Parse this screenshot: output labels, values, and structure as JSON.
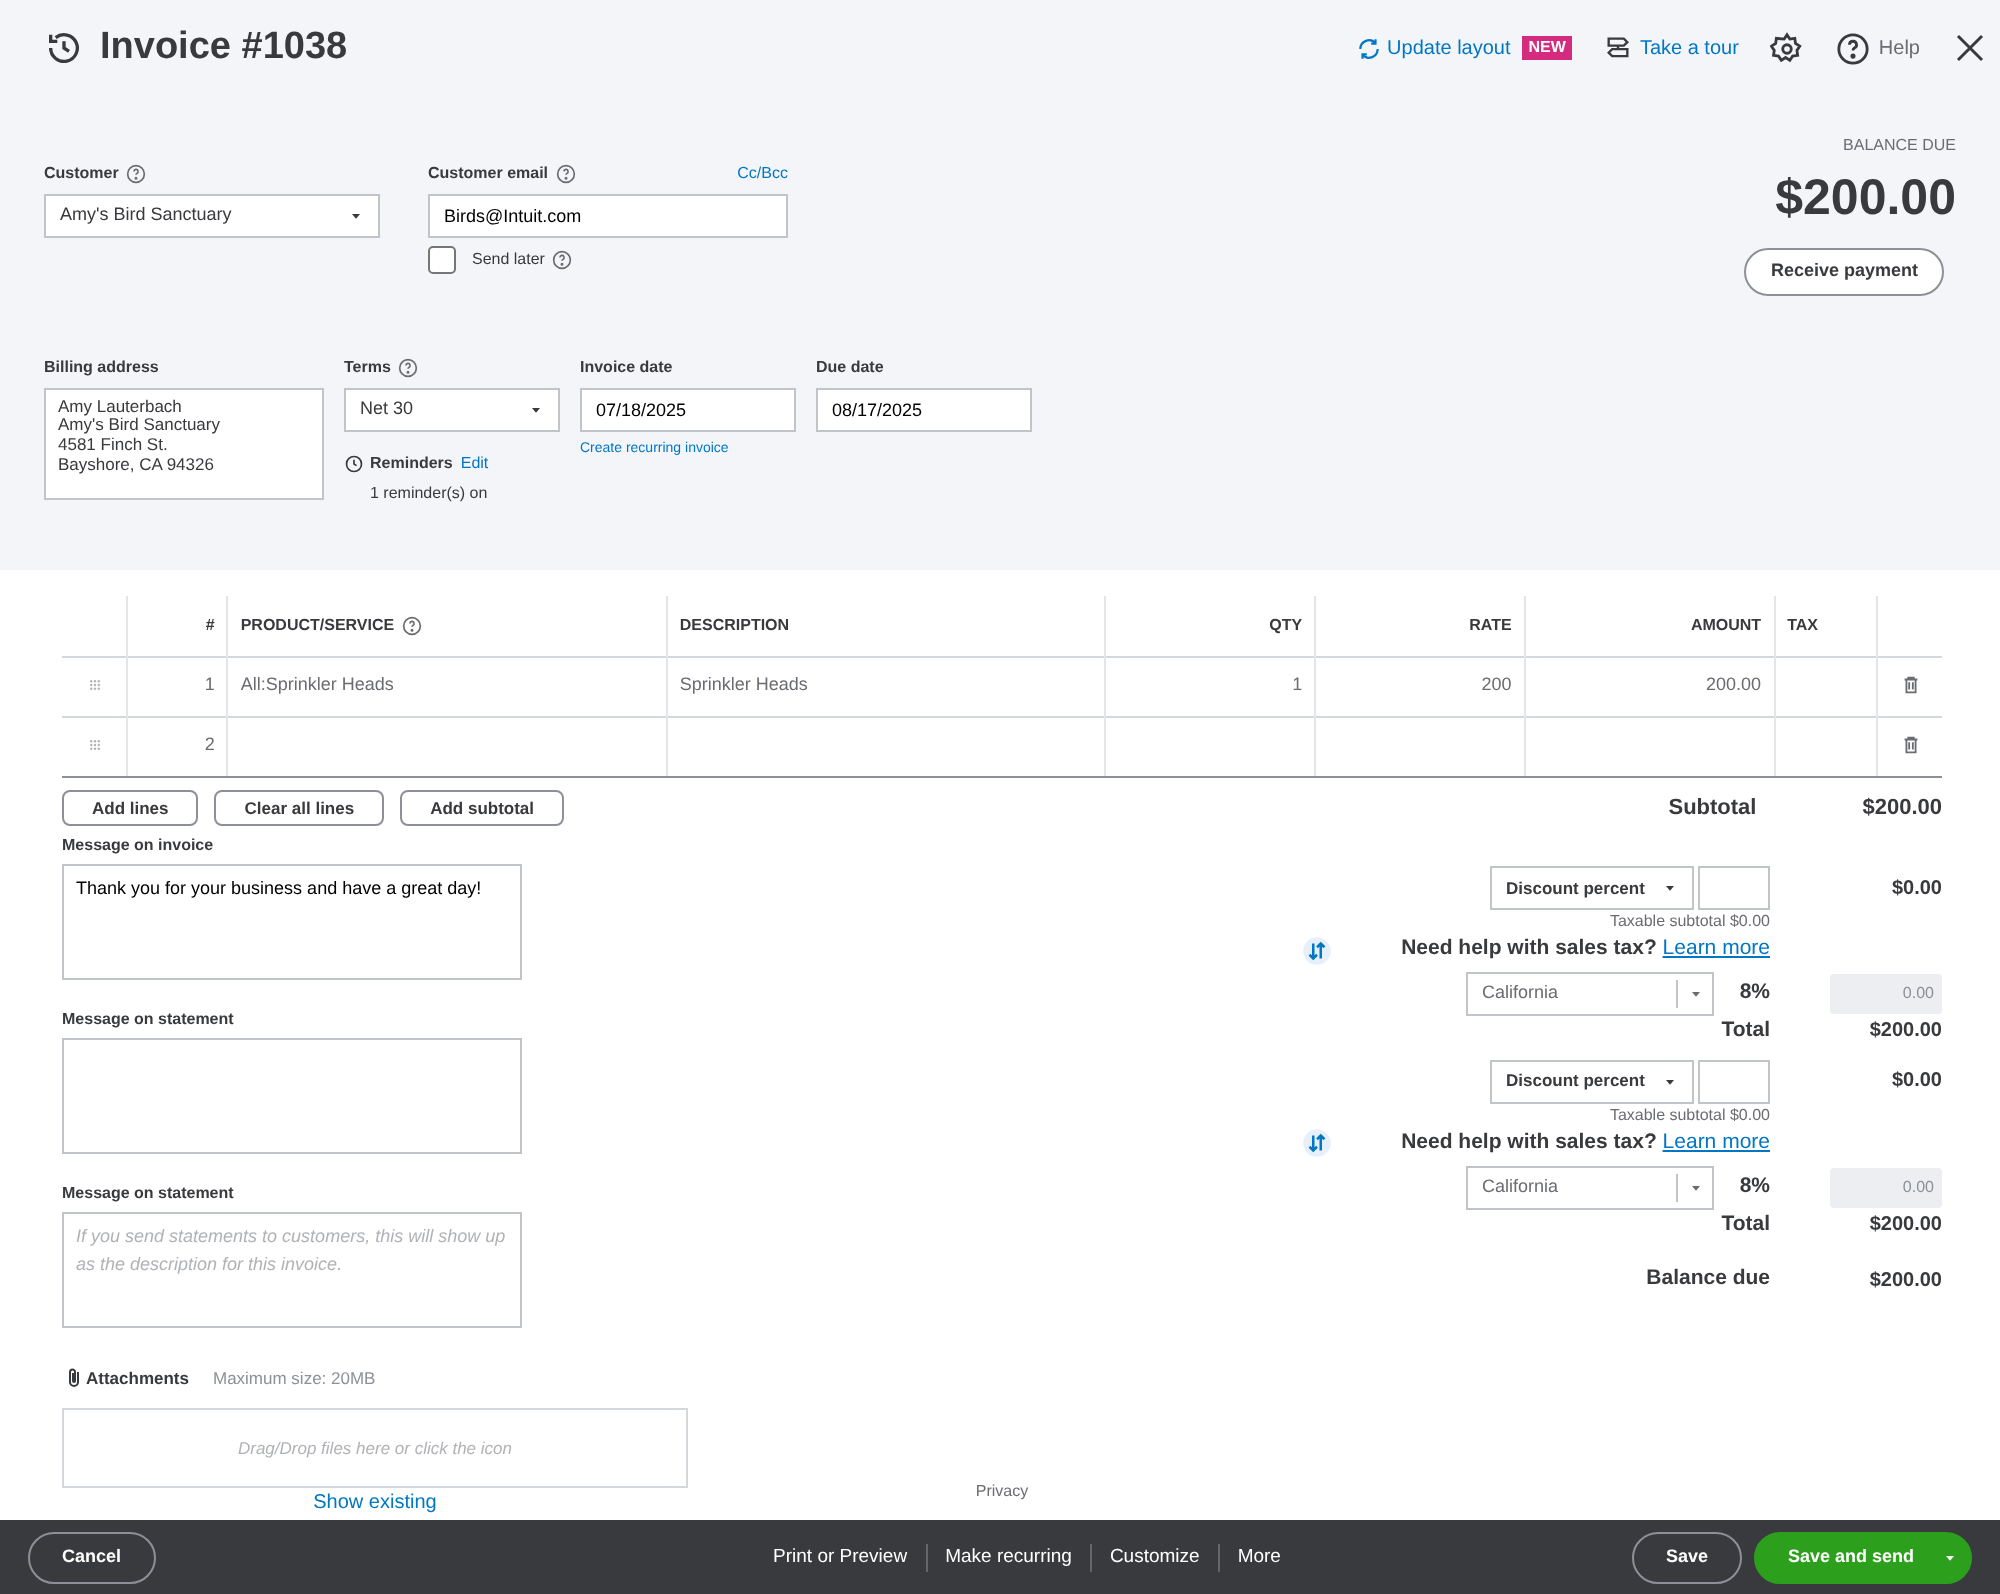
{
  "header": {
    "title": "Invoice #1038",
    "update_layout": "Update layout",
    "new_badge": "NEW",
    "take_tour": "Take a tour",
    "help": "Help"
  },
  "customer": {
    "label": "Customer",
    "value": "Amy's Bird Sanctuary"
  },
  "email": {
    "label": "Customer email",
    "value": "Birds@Intuit.com",
    "cc_bcc": "Cc/Bcc",
    "send_later": {
      "label": "Send later",
      "checked": false
    }
  },
  "balance": {
    "label": "BALANCE DUE",
    "amount": "$200.00",
    "button": "Receive payment"
  },
  "billing": {
    "label": "Billing address",
    "lines": [
      "Amy Lauterbach",
      "Amy's Bird Sanctuary",
      "4581 Finch St.",
      "Bayshore, CA  94326"
    ]
  },
  "terms": {
    "label": "Terms",
    "value": "Net 30"
  },
  "invoice_date": {
    "label": "Invoice date",
    "value": "07/18/2025",
    "link": "Create recurring invoice"
  },
  "due_date": {
    "label": "Due date",
    "value": "08/17/2025"
  },
  "reminders": {
    "label": "Reminders",
    "edit": "Edit",
    "status": "1 reminder(s) on"
  },
  "table": {
    "columns": [
      "#",
      "PRODUCT/SERVICE",
      "DESCRIPTION",
      "QTY",
      "RATE",
      "AMOUNT",
      "TAX"
    ],
    "rows": [
      {
        "num": "1",
        "product": "All:Sprinkler Heads",
        "description": "Sprinkler Heads",
        "qty": "1",
        "rate": "200",
        "amount": "200.00"
      },
      {
        "num": "2"
      }
    ]
  },
  "line_buttons": [
    "Add lines",
    "Clear all lines",
    "Add subtotal"
  ],
  "subtotal": {
    "label": "Subtotal",
    "value": "$200.00"
  },
  "messages": [
    {
      "label": "Message on invoice",
      "value": "Thank you for your business and have a great day!"
    },
    {
      "label": "Message on statement"
    },
    {
      "label": "Message on statement",
      "placeholder": "If you send statements to customers, this will show up as the description for this invoice."
    }
  ],
  "attachments": {
    "label": "Attachments",
    "max": "Maximum size: 20MB",
    "drop": "Drag/Drop files here or click the icon",
    "show": "Show existing"
  },
  "tax_blocks": [
    {
      "discount": "Discount percent",
      "discount_amount": "$0.00",
      "taxable": "Taxable subtotal $0.00",
      "help": "Need help with sales tax?",
      "learn": "Learn more",
      "state": "California",
      "rate": "8%",
      "tax_amount": "0.00",
      "total_label": "Total",
      "total": "$200.00"
    },
    {
      "discount": "Discount percent",
      "discount_amount": "$0.00",
      "taxable": "Taxable subtotal $0.00",
      "help": "Need help with sales tax?",
      "learn": "Learn more",
      "state": "California",
      "rate": "8%",
      "tax_amount": "0.00",
      "total_label": "Total",
      "total": "$200.00"
    }
  ],
  "balance_due": {
    "label": "Balance due",
    "value": "$200.00"
  },
  "privacy": "Privacy",
  "footer": {
    "cancel": "Cancel",
    "center": [
      "Print or Preview",
      "Make recurring",
      "Customize",
      "More"
    ],
    "save": "Save",
    "save_send": "Save and send"
  }
}
